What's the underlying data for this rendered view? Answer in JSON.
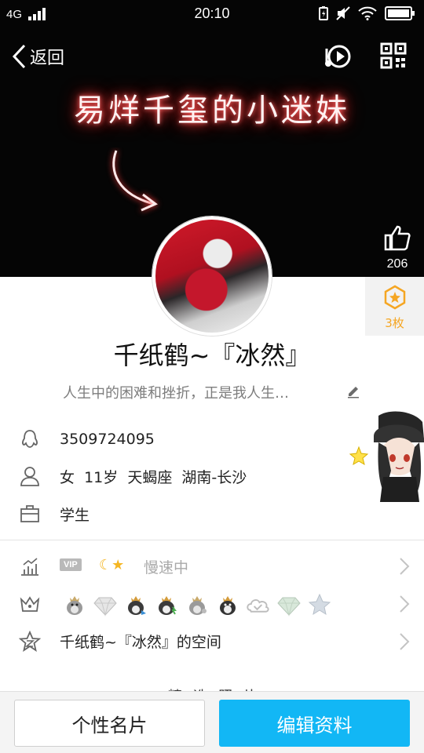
{
  "status_bar": {
    "network": "4G",
    "time": "20:10"
  },
  "header": {
    "back_label": "返回",
    "cover_text": "易烊千玺的小迷妹"
  },
  "like": {
    "count": "206"
  },
  "star_badge": {
    "count": "3枚"
  },
  "profile": {
    "nickname": "千纸鹤~『冰然』",
    "signature": "人生中的困难和挫折，正是我人生…",
    "qq_number": "3509724095",
    "basic_info": "女  11岁  天蝎座  湖南-长沙",
    "occupation": "学生"
  },
  "vip_row": {
    "tag": "VIP",
    "status": "慢速中"
  },
  "badge_row": {
    "medals": [
      "penguin-crown-icon",
      "diamond-icon",
      "penguin-crown-icon",
      "penguin-crown-icon",
      "penguin-crown-icon",
      "penguin-crown-icon",
      "cloud-icon",
      "diamond-icon",
      "star-icon"
    ]
  },
  "space_row": {
    "label": "千纸鹤~『冰然』的空间"
  },
  "partial_text": "精选照片",
  "bottom": {
    "card_label": "个性名片",
    "edit_label": "编辑资料"
  },
  "colors": {
    "accent": "#12b7f5",
    "gold": "#f5a623",
    "neon": "#ff3b3b"
  }
}
